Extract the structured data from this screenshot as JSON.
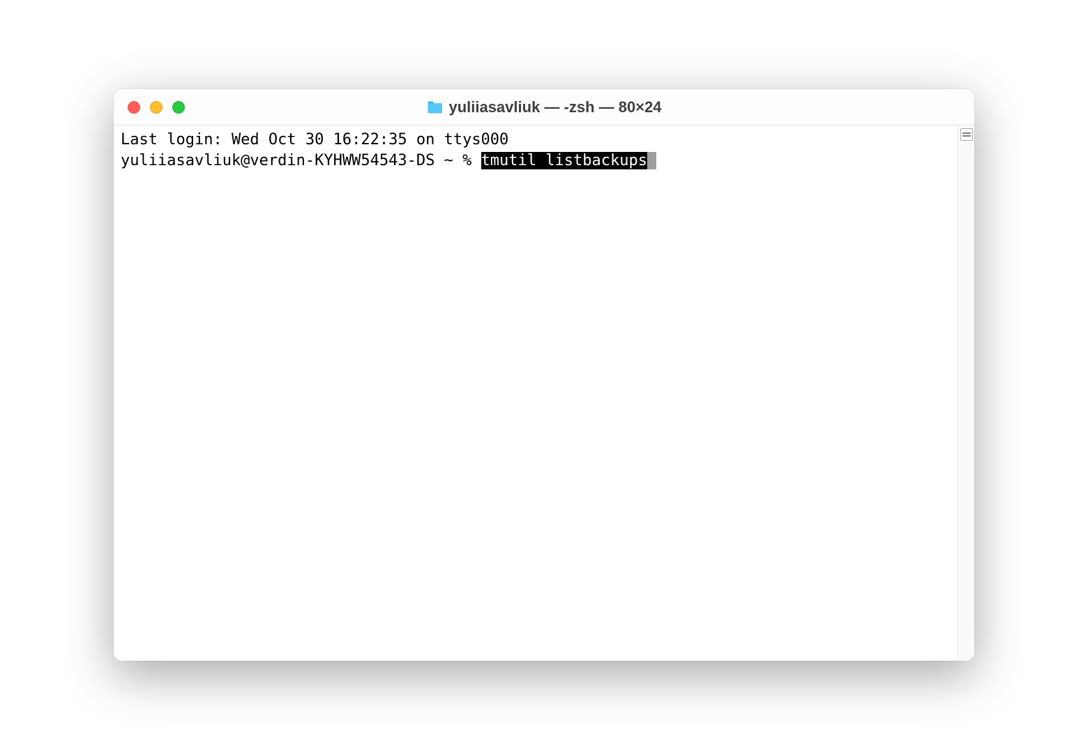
{
  "window": {
    "title": "yuliiasavliuk — -zsh — 80×24"
  },
  "terminal": {
    "last_login": "Last login: Wed Oct 30 16:22:35 on ttys000",
    "prompt": "yuliiasavliuk@verdin-KYHWW54543-DS ~ % ",
    "command": "tmutil listbackups",
    "cursor": " "
  }
}
